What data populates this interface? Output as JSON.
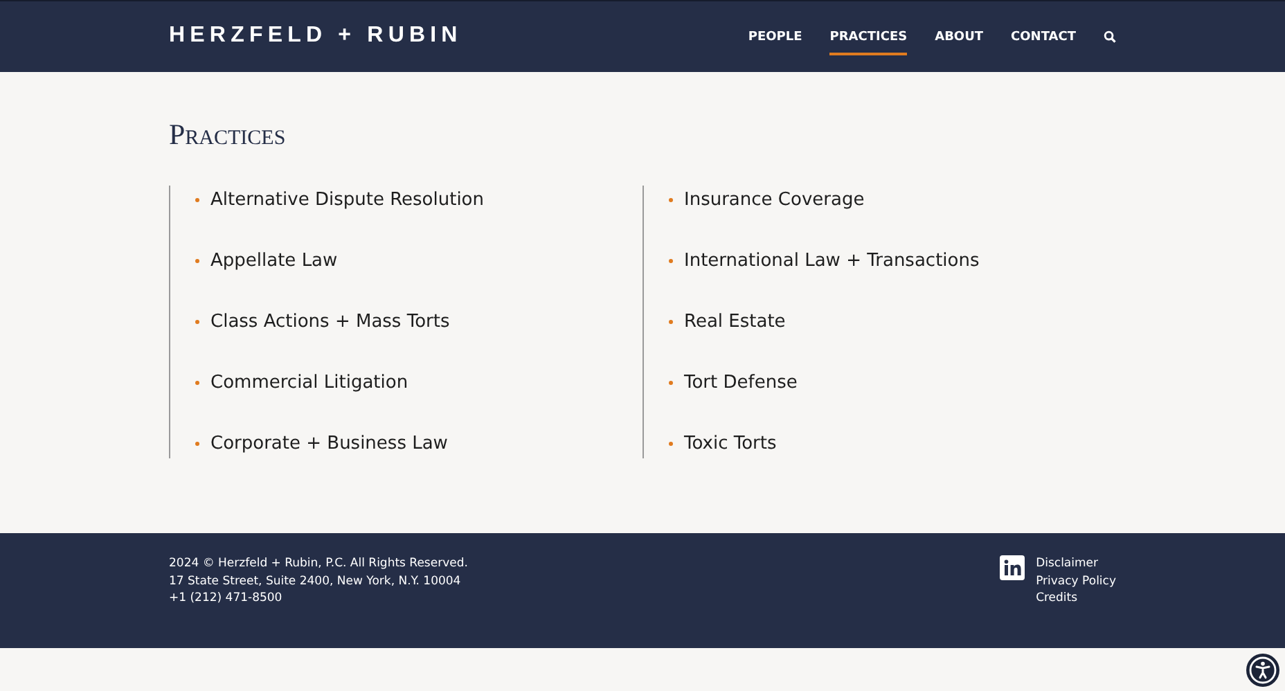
{
  "header": {
    "logo": "HERZFELD + RUBIN",
    "nav": [
      {
        "label": "PEOPLE",
        "selected": false
      },
      {
        "label": "PRACTICES",
        "selected": true
      },
      {
        "label": "ABOUT",
        "selected": false
      },
      {
        "label": "CONTACT",
        "selected": false
      }
    ]
  },
  "heading": "Practices",
  "practice_columns": [
    [
      "Alternative Dispute Resolution",
      "Appellate Law",
      "Class Actions + Mass Torts",
      "Commercial Litigation",
      "Corporate + Business Law"
    ],
    [
      "Insurance Coverage",
      "International Law + Transactions",
      "Real Estate",
      "Tort Defense",
      "Toxic Torts"
    ]
  ],
  "footer": {
    "lines": [
      "2024 © Herzfeld + Rubin, P.C. All Rights Reserved.",
      "17 State Street, Suite 2400, New York, N.Y. 10004",
      "+1 (212) 471-8500"
    ],
    "links": [
      "Disclaimer",
      "Privacy Policy",
      "Credits"
    ]
  }
}
